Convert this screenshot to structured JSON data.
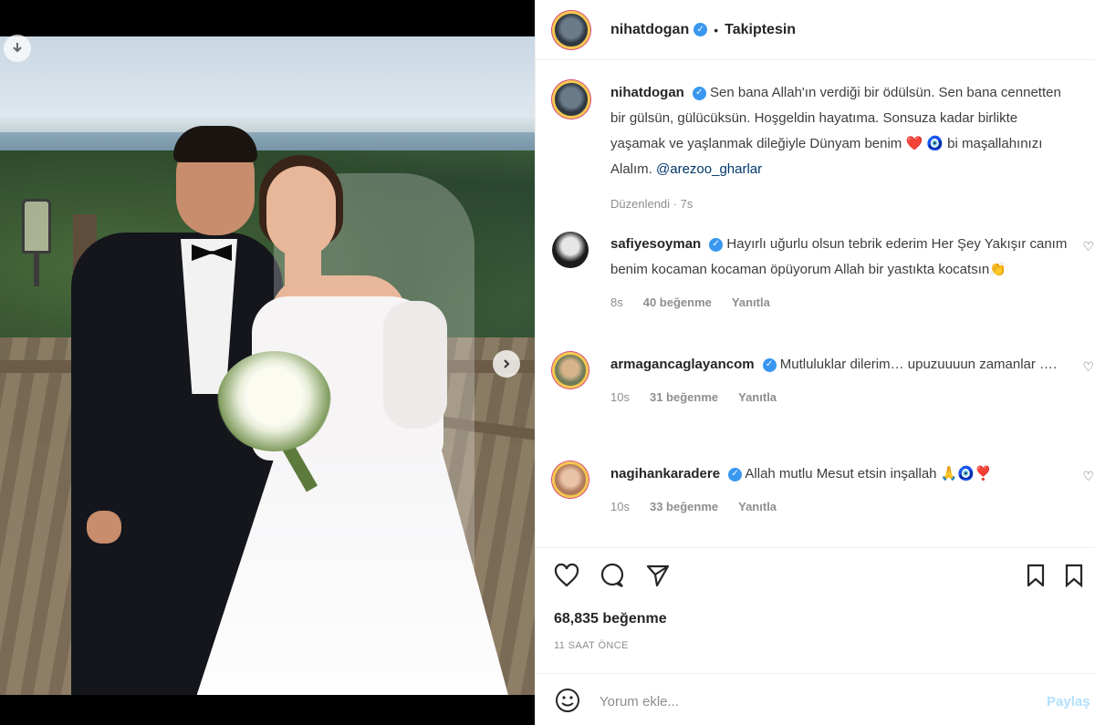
{
  "post": {
    "image_alt": "Wedding photo",
    "carousel": {
      "dot_count": 3,
      "active_index": 0
    }
  },
  "header": {
    "username": "nihatdogan",
    "follow_status": "Takiptesin"
  },
  "caption": {
    "username": "nihatdogan",
    "text": "Sen bana Allah'ın verdiği bir ödülsün. Sen bana cennetten bir gülsün, gülücüksün. Hoşgeldin hayatıma. Sonsuza kadar birlikte yaşamak ve yaşlanmak dileğiyle Dünyam benim ❤️ 🧿 bi maşallahınızı Alalım.",
    "mention": "@arezoo_gharlar",
    "edited": "Düzenlendi · 7s"
  },
  "comments": [
    {
      "username": "safiyesoyman",
      "text": "Hayırlı uğurlu olsun tebrik ederim Her Şey Yakışır canım benim kocaman kocaman öpüyorum Allah bir yastıkta kocatsın👏",
      "time": "8s",
      "likes": "40 beğenme",
      "reply": "Yanıtla"
    },
    {
      "username": "armagancaglayancom",
      "text": "Mutluluklar dilerim… upuzuuuun zamanlar ….",
      "time": "10s",
      "likes": "31 beğenme",
      "reply": "Yanıtla"
    },
    {
      "username": "nagihankaradere",
      "text": "Allah mutlu Mesut etsin inşallah 🙏🧿❣️",
      "time": "10s",
      "likes": "33 beğenme",
      "reply": "Yanıtla"
    }
  ],
  "stats": {
    "likes": "68,835 beğenme",
    "time": "11 SAAT ÖNCE"
  },
  "composer": {
    "placeholder": "Yorum ekle...",
    "share": "Paylaş"
  },
  "icons": {
    "like": "heart-icon",
    "comment": "comment-icon",
    "share": "send-icon",
    "save": "bookmark-icon",
    "emoji": "smiley-icon"
  }
}
